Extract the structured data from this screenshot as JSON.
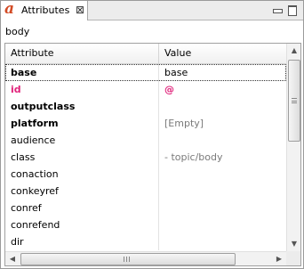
{
  "view": {
    "tab_icon_glyph": "a",
    "tab_title": "Attributes",
    "close_glyph": "⊠",
    "accent_color": "#d24a24"
  },
  "context_label": "body",
  "table": {
    "headers": [
      "Attribute",
      "Value"
    ],
    "rows": [
      {
        "attribute": "base",
        "value": "base",
        "style": "bold",
        "selected": true
      },
      {
        "attribute": "id",
        "value": "@",
        "style": "bold-pink"
      },
      {
        "attribute": "outputclass",
        "value": "",
        "style": "bold"
      },
      {
        "attribute": "platform",
        "value": "[Empty]",
        "style": "bold",
        "value_style": "gray"
      },
      {
        "attribute": "audience",
        "value": ""
      },
      {
        "attribute": "class",
        "value": "- topic/body",
        "value_style": "gray"
      },
      {
        "attribute": "conaction",
        "value": ""
      },
      {
        "attribute": "conkeyref",
        "value": ""
      },
      {
        "attribute": "conref",
        "value": ""
      },
      {
        "attribute": "conrefend",
        "value": ""
      },
      {
        "attribute": "dir",
        "value": ""
      }
    ]
  },
  "scrollbars": {
    "vertical_position": 0,
    "horizontal_position": 0
  },
  "colors": {
    "required_attribute": "#e0227a",
    "default_value": "#7a7a7a"
  }
}
